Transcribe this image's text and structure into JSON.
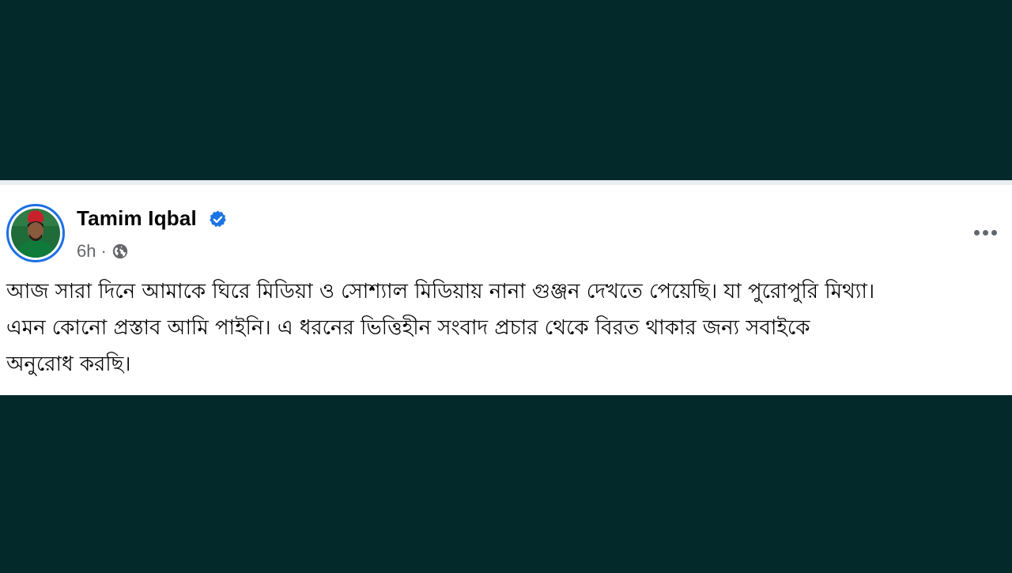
{
  "post": {
    "author_name": "Tamim Iqbal",
    "time_ago": "6h",
    "separator": "·",
    "privacy_icon": "globe-icon",
    "verified_icon": "verified-badge-icon",
    "more_icon": "more-options-icon",
    "text_lines": [
      "আজ সারা দিনে আমাকে ঘিরে মিডিয়া ও সোশ্যাল মিডিয়ায় নানা গুঞ্জন দেখতে পেয়েছি। যা পুরোপুরি মিথ্যা।",
      "এমন কোনো প্রস্তাব আমি পাইনি। এ ধরনের ভিত্তিহীন সংবাদ প্রচার থেকে বিরত থাকার জন্য সবাইকে",
      "অনুরোধ করছি।"
    ]
  },
  "colors": {
    "background": "#04292b",
    "card": "#ffffff",
    "verified": "#1b74e4",
    "avatar_ring": "#1b6fe6",
    "meta_text": "#65676b"
  }
}
